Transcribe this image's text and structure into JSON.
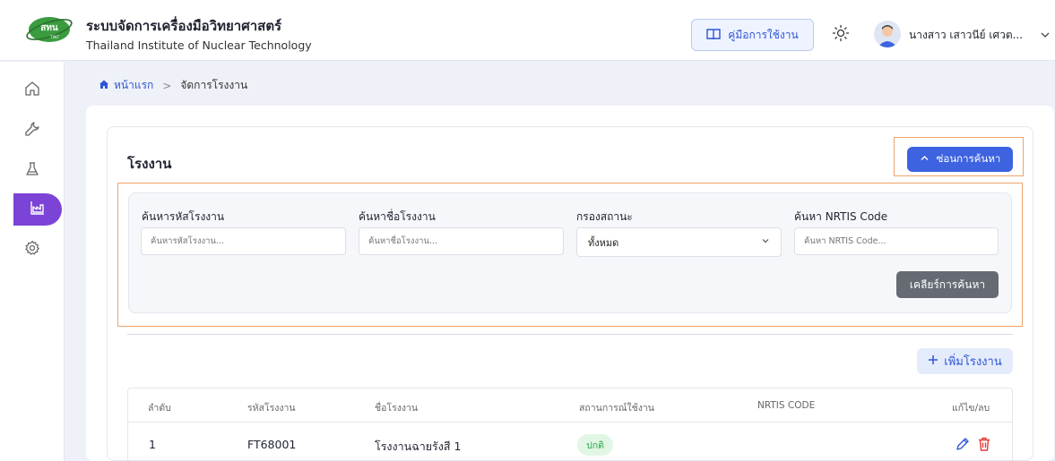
{
  "header": {
    "logo_text": "สทน",
    "logo_subtext": "TINT",
    "title": "ระบบจัดการเครื่องมือวิทยาศาสตร์",
    "subtitle": "Thailand Institute of Nuclear Technology",
    "manual_label": "คู่มือการใช้งาน",
    "user_name": "นางสาว เสาวนีย์ เศวต..."
  },
  "sidebar": {
    "items": [
      {
        "icon": "home-icon"
      },
      {
        "icon": "wrench-icon"
      },
      {
        "icon": "flask-icon"
      },
      {
        "icon": "factory-icon",
        "active": true
      },
      {
        "icon": "gear-icon"
      }
    ]
  },
  "breadcrumb": {
    "home": "หน้าแรก",
    "separator": ">",
    "current": "จัดการโรงงาน"
  },
  "section": {
    "title": "โรงงาน",
    "hide_search_label": "ซ่อนการค้นหา"
  },
  "search": {
    "code_label": "ค้นหารหัสโรงงาน",
    "code_placeholder": "ค้นหารหัสโรงงาน...",
    "name_label": "ค้นหาชื่อโรงงาน",
    "name_placeholder": "ค้นหาชื่อโรงงาน...",
    "status_label": "กรองสถานะ",
    "status_value": "ทั้งหมด",
    "nrtis_label": "ค้นหา NRTIS Code",
    "nrtis_placeholder": "ค้นหา NRTIS Code...",
    "clear_label": "เคลียร์การค้นหา"
  },
  "actions": {
    "add_label": "เพิ่มโรงงาน"
  },
  "table": {
    "headers": [
      "ลำดับ",
      "รหัสโรงงาน",
      "ชื่อโรงงาน",
      "สถานการณ์ใช้งาน",
      "NRTIS CODE",
      "แก้ไข/ลบ"
    ],
    "rows": [
      {
        "index": "1",
        "code": "FT68001",
        "name": "โรงงานฉายรังสี 1",
        "status": "ปกติ",
        "nrtis": ""
      }
    ]
  },
  "colors": {
    "primary": "#3d63e0",
    "sidebar_active": "#7b43d6",
    "highlight": "#f0a36a",
    "status_ok": "#28a745",
    "delete": "#e53935"
  }
}
